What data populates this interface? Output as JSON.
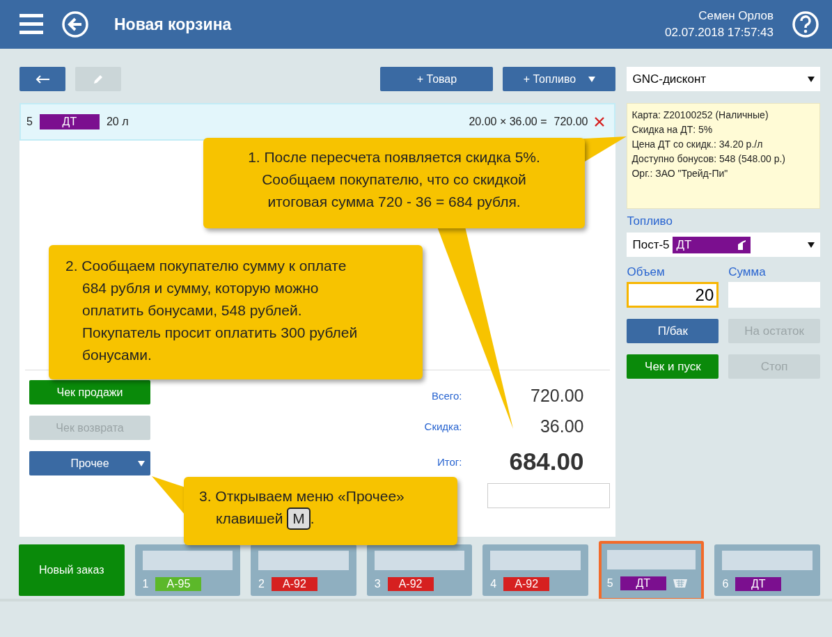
{
  "header": {
    "title": "Новая корзина",
    "user": "Семен Орлов",
    "datetime": "02.07.2018 17:57:43"
  },
  "toolbar": {
    "add_product": "+ Товар",
    "add_fuel": "+ Топливо"
  },
  "discount_select": {
    "value": "GNC-дисконт"
  },
  "cart": {
    "items": [
      {
        "number": "5",
        "fuel": "ДТ",
        "color": "#7b0f8f",
        "volume": "20 л",
        "calc": "20.00 × 36.00 =",
        "amount": "720.00"
      }
    ]
  },
  "card_info": [
    "Карта: Z20100252 (Наличные)",
    "Скидка на ДТ: 5%",
    "Цена ДТ со скидк.: 34.20 р./л",
    "Доступно бонусов: 548 (548.00 р.)",
    "Орг.: ЗАО \"Трейд-Пи\""
  ],
  "fuel": {
    "label": "Топливо",
    "pump": "Пост-5",
    "fuel": "ДТ",
    "color": "#7b0f8f"
  },
  "volume": {
    "label": "Объем",
    "value": "20",
    "focused": true
  },
  "sum": {
    "label": "Сумма",
    "focused": false
  },
  "fuel_buttons": [
    {
      "label": "П/бак",
      "kind": "primary",
      "disabled": false
    },
    {
      "label": "На остаток",
      "kind": "primary",
      "disabled": true
    },
    {
      "label": "Чек и пуск",
      "kind": "success",
      "disabled": false
    },
    {
      "label": "Стоп",
      "kind": "success",
      "disabled": true
    }
  ],
  "actions": [
    {
      "label": "Чек продажи",
      "kind": "success",
      "disabled": false
    },
    {
      "label": "Чек возврата",
      "kind": "success",
      "disabled": true
    },
    {
      "label": "Прочее",
      "kind": "dropdown",
      "disabled": false
    }
  ],
  "totals": [
    {
      "label": "Всего:",
      "value": "720.00",
      "kind": "normal"
    },
    {
      "label": "Скидка:",
      "value": "36.00",
      "kind": "normal"
    },
    {
      "label": "Итог:",
      "value": "684.00",
      "kind": "grand"
    }
  ],
  "callouts": [
    {
      "lines": [
        "1. После пересчета появляется скидка 5%.",
        "Сообщаем покупателю, что со скидкой",
        "итоговая сумма 720 - 36 = 684 рубля."
      ]
    },
    {
      "lines": [
        "2. Сообщаем покупателю сумму к оплате",
        "684 рубля и сумму, которую можно",
        "оплатить бонусами, 548 рублей.",
        "Покупатель просит оплатить 300 рублей",
        "бонусами."
      ]
    },
    {
      "lines": [
        "3. Открываем меню «Прочее»",
        "клавишей"
      ],
      "key": "M",
      "after": "."
    }
  ],
  "new_order": "Новый заказ",
  "pumps": [
    {
      "number": "1",
      "fuel": "А-95",
      "color": "#5cb82a",
      "selected": false,
      "cart": false
    },
    {
      "number": "2",
      "fuel": "А-92",
      "color": "#d62020",
      "selected": false,
      "cart": false
    },
    {
      "number": "3",
      "fuel": "А-92",
      "color": "#d62020",
      "selected": false,
      "cart": false
    },
    {
      "number": "4",
      "fuel": "А-92",
      "color": "#d62020",
      "selected": false,
      "cart": false
    },
    {
      "number": "5",
      "fuel": "ДТ",
      "color": "#7b0f8f",
      "selected": true,
      "cart": true
    },
    {
      "number": "6",
      "fuel": "ДТ",
      "color": "#7b0f8f",
      "selected": false,
      "cart": false
    }
  ]
}
